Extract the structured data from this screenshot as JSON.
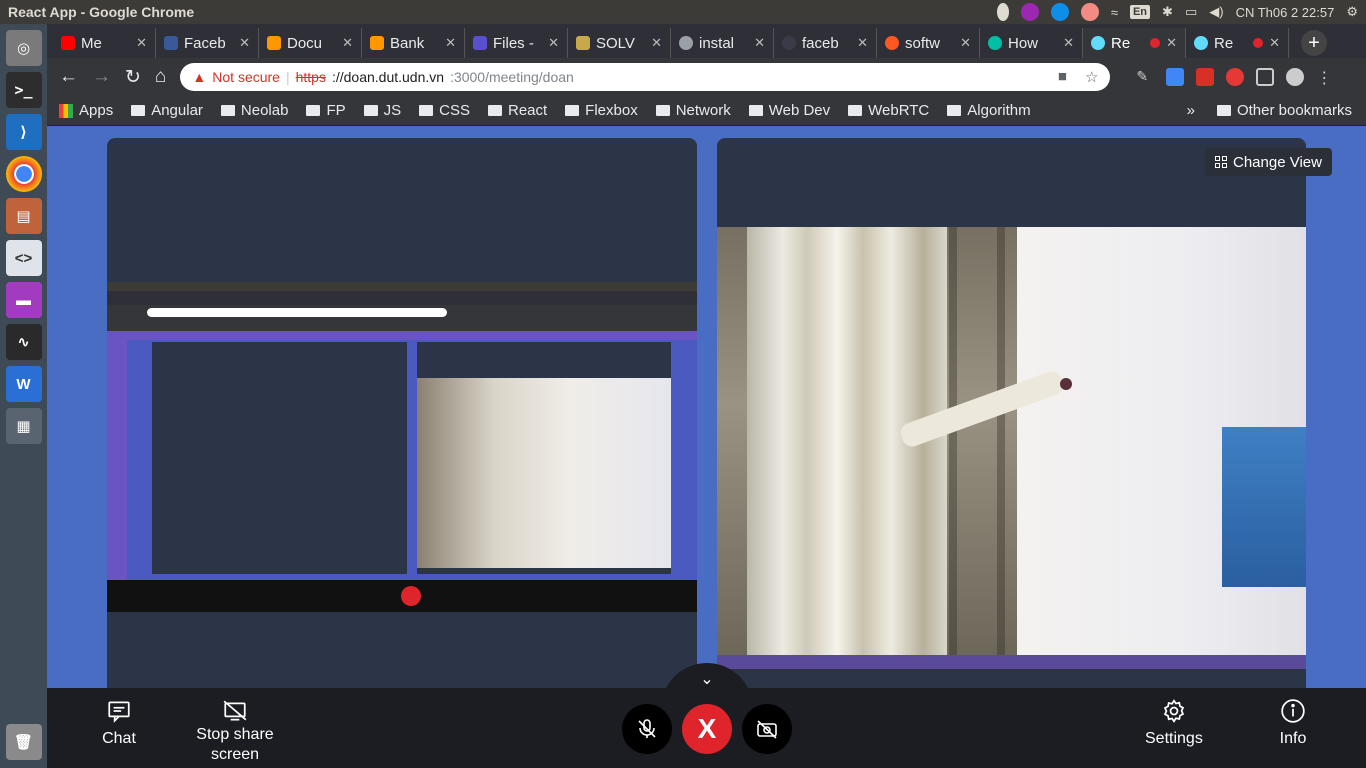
{
  "window": {
    "title": "React App - Google Chrome"
  },
  "system_tray": {
    "language": "En",
    "datetime": "CN Th06  2 22:57"
  },
  "launcher": {
    "apps": [
      "ubuntu-icon",
      "terminal-icon",
      "vscode-icon",
      "chrome-icon",
      "files-icon",
      "code-editor-icon",
      "purple-app-icon",
      "system-monitor-icon",
      "writer-icon",
      "workspace-icon"
    ],
    "trash": "trash-icon"
  },
  "tabs": [
    {
      "label": "Me",
      "color": "#ff0000"
    },
    {
      "label": "Faceb",
      "color": "#3b5998"
    },
    {
      "label": "Docu",
      "color": "#ff9800"
    },
    {
      "label": "Bank",
      "color": "#ff9800"
    },
    {
      "label": "Files -",
      "color": "#5a4fcf"
    },
    {
      "label": "SOLV",
      "color": "#c7a94a"
    },
    {
      "label": "instal",
      "color": "#9aa0a6"
    },
    {
      "label": "faceb",
      "color": "#3b3b48"
    },
    {
      "label": "softw",
      "color": "#ff5722"
    },
    {
      "label": "How",
      "color": "#00bfa5"
    },
    {
      "label": "Re",
      "color": "#61dafb",
      "active": true
    },
    {
      "label": "Re",
      "color": "#61dafb"
    }
  ],
  "omnibox": {
    "security": "Not secure",
    "scheme": "https",
    "host": "://doan.dut.udn.vn",
    "path": ":3000/meeting/doan"
  },
  "bookmarks": {
    "apps": "Apps",
    "folders": [
      "Angular",
      "Neolab",
      "FP",
      "JS",
      "CSS",
      "React",
      "Flexbox",
      "Network",
      "Web Dev",
      "WebRTC",
      "Algorithm"
    ],
    "overflow": "»",
    "other": "Other bookmarks"
  },
  "meeting": {
    "change_view": "Change View",
    "chat": "Chat",
    "stop_share_line1": "Stop share",
    "stop_share_line2": "screen",
    "settings": "Settings",
    "info": "Info",
    "end_call": "X"
  },
  "colors": {
    "page_bg": "#4a6dc4",
    "tile_bg": "#2c3447",
    "control_bar": "#1b1d22",
    "end_call": "#e0242c"
  }
}
